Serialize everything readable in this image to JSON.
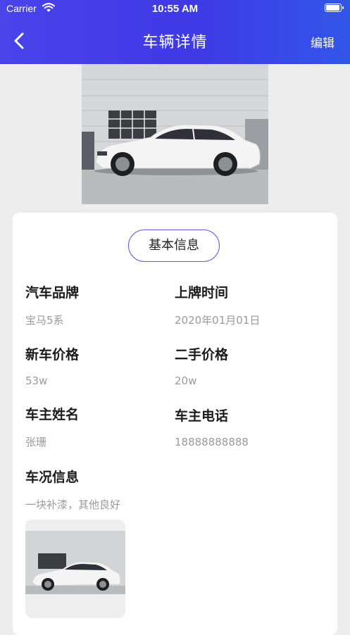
{
  "status_bar": {
    "carrier": "Carrier",
    "time": "10:55 AM"
  },
  "nav": {
    "title": "车辆详情",
    "edit_label": "编辑"
  },
  "section": {
    "title": "基本信息"
  },
  "fields": {
    "brand": {
      "label": "汽车品牌",
      "value": "宝马5系"
    },
    "reg_date": {
      "label": "上牌时间",
      "value": "2020年01月01日"
    },
    "new_price": {
      "label": "新车价格",
      "value": "53w"
    },
    "used_price": {
      "label": "二手价格",
      "value": "20w"
    },
    "owner_name": {
      "label": "车主姓名",
      "value": "张珊"
    },
    "owner_phone": {
      "label": "车主电话",
      "value": "18888888888"
    },
    "condition": {
      "label": "车况信息",
      "value": "一块补漆，其他良好"
    }
  },
  "colors": {
    "header_start": "#4a43ea",
    "header_end": "#3256e8",
    "pill_border": "#6a52e6"
  },
  "icons": {
    "back": "chevron-left-icon",
    "wifi": "wifi-icon",
    "battery": "battery-icon"
  }
}
